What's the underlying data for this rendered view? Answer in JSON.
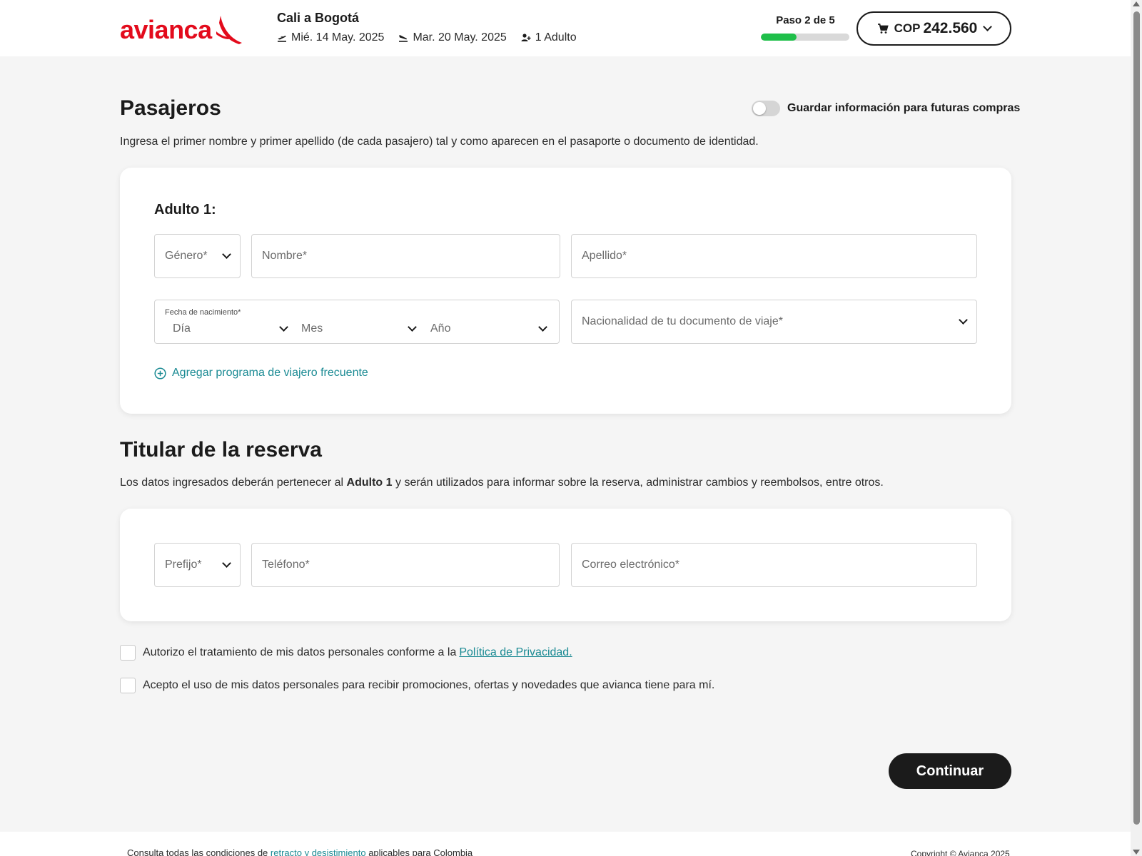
{
  "header": {
    "logo_text": "avianca",
    "trip_title": "Cali a Bogotá",
    "departure_date": "Mié. 14 May. 2025",
    "return_date": "Mar. 20 May. 2025",
    "passengers": "1 Adulto",
    "step_label": "Paso 2 de 5",
    "step_progress": 0.4,
    "cart_currency": "COP",
    "cart_amount": "242.560"
  },
  "colors": {
    "brand": "#e30b1c",
    "progress": "#1fbf4a",
    "link": "#1a8a93",
    "button": "#1b1b1b"
  },
  "passengers_section": {
    "title": "Pasajeros",
    "save_toggle_label": "Guardar información para futuras compras",
    "save_toggle_on": false,
    "description": "Ingresa el primer nombre y primer apellido (de cada pasajero) tal y como aparecen en el pasaporte o documento de identidad.",
    "adult_title": "Adulto 1:",
    "gender_placeholder": "Género*",
    "name_placeholder": "Nombre*",
    "lastname_placeholder": "Apellido*",
    "dob_label": "Fecha de nacimiento*",
    "day_placeholder": "Día",
    "month_placeholder": "Mes",
    "year_placeholder": "Año",
    "nationality_placeholder": "Nacionalidad de tu documento de viaje*",
    "frequent_flyer_link": "Agregar programa de viajero frecuente"
  },
  "holder_section": {
    "title": "Titular de la reserva",
    "desc_before": "Los datos ingresados deberán pertenecer al ",
    "desc_bold": "Adulto 1",
    "desc_after": " y serán utilizados para informar sobre la reserva, administrar cambios y reembolsos, entre otros.",
    "prefix_placeholder": "Prefijo*",
    "phone_placeholder": "Teléfono*",
    "email_placeholder": "Correo electrónico*"
  },
  "consents": {
    "privacy_text": "Autorizo el tratamiento de mis datos personales conforme a la ",
    "privacy_link": "Política de Privacidad.",
    "promo_text": "Acepto el uso de mis datos personales para recibir promociones, ofertas y novedades que avianca tiene para mí."
  },
  "actions": {
    "continue_label": "Continuar"
  },
  "footer": {
    "left_before": "Consulta todas las condiciones de ",
    "left_link": "retracto y desistimiento",
    "left_after": " aplicables para Colombia",
    "copyright": "Copyright © Avianca 2025"
  }
}
